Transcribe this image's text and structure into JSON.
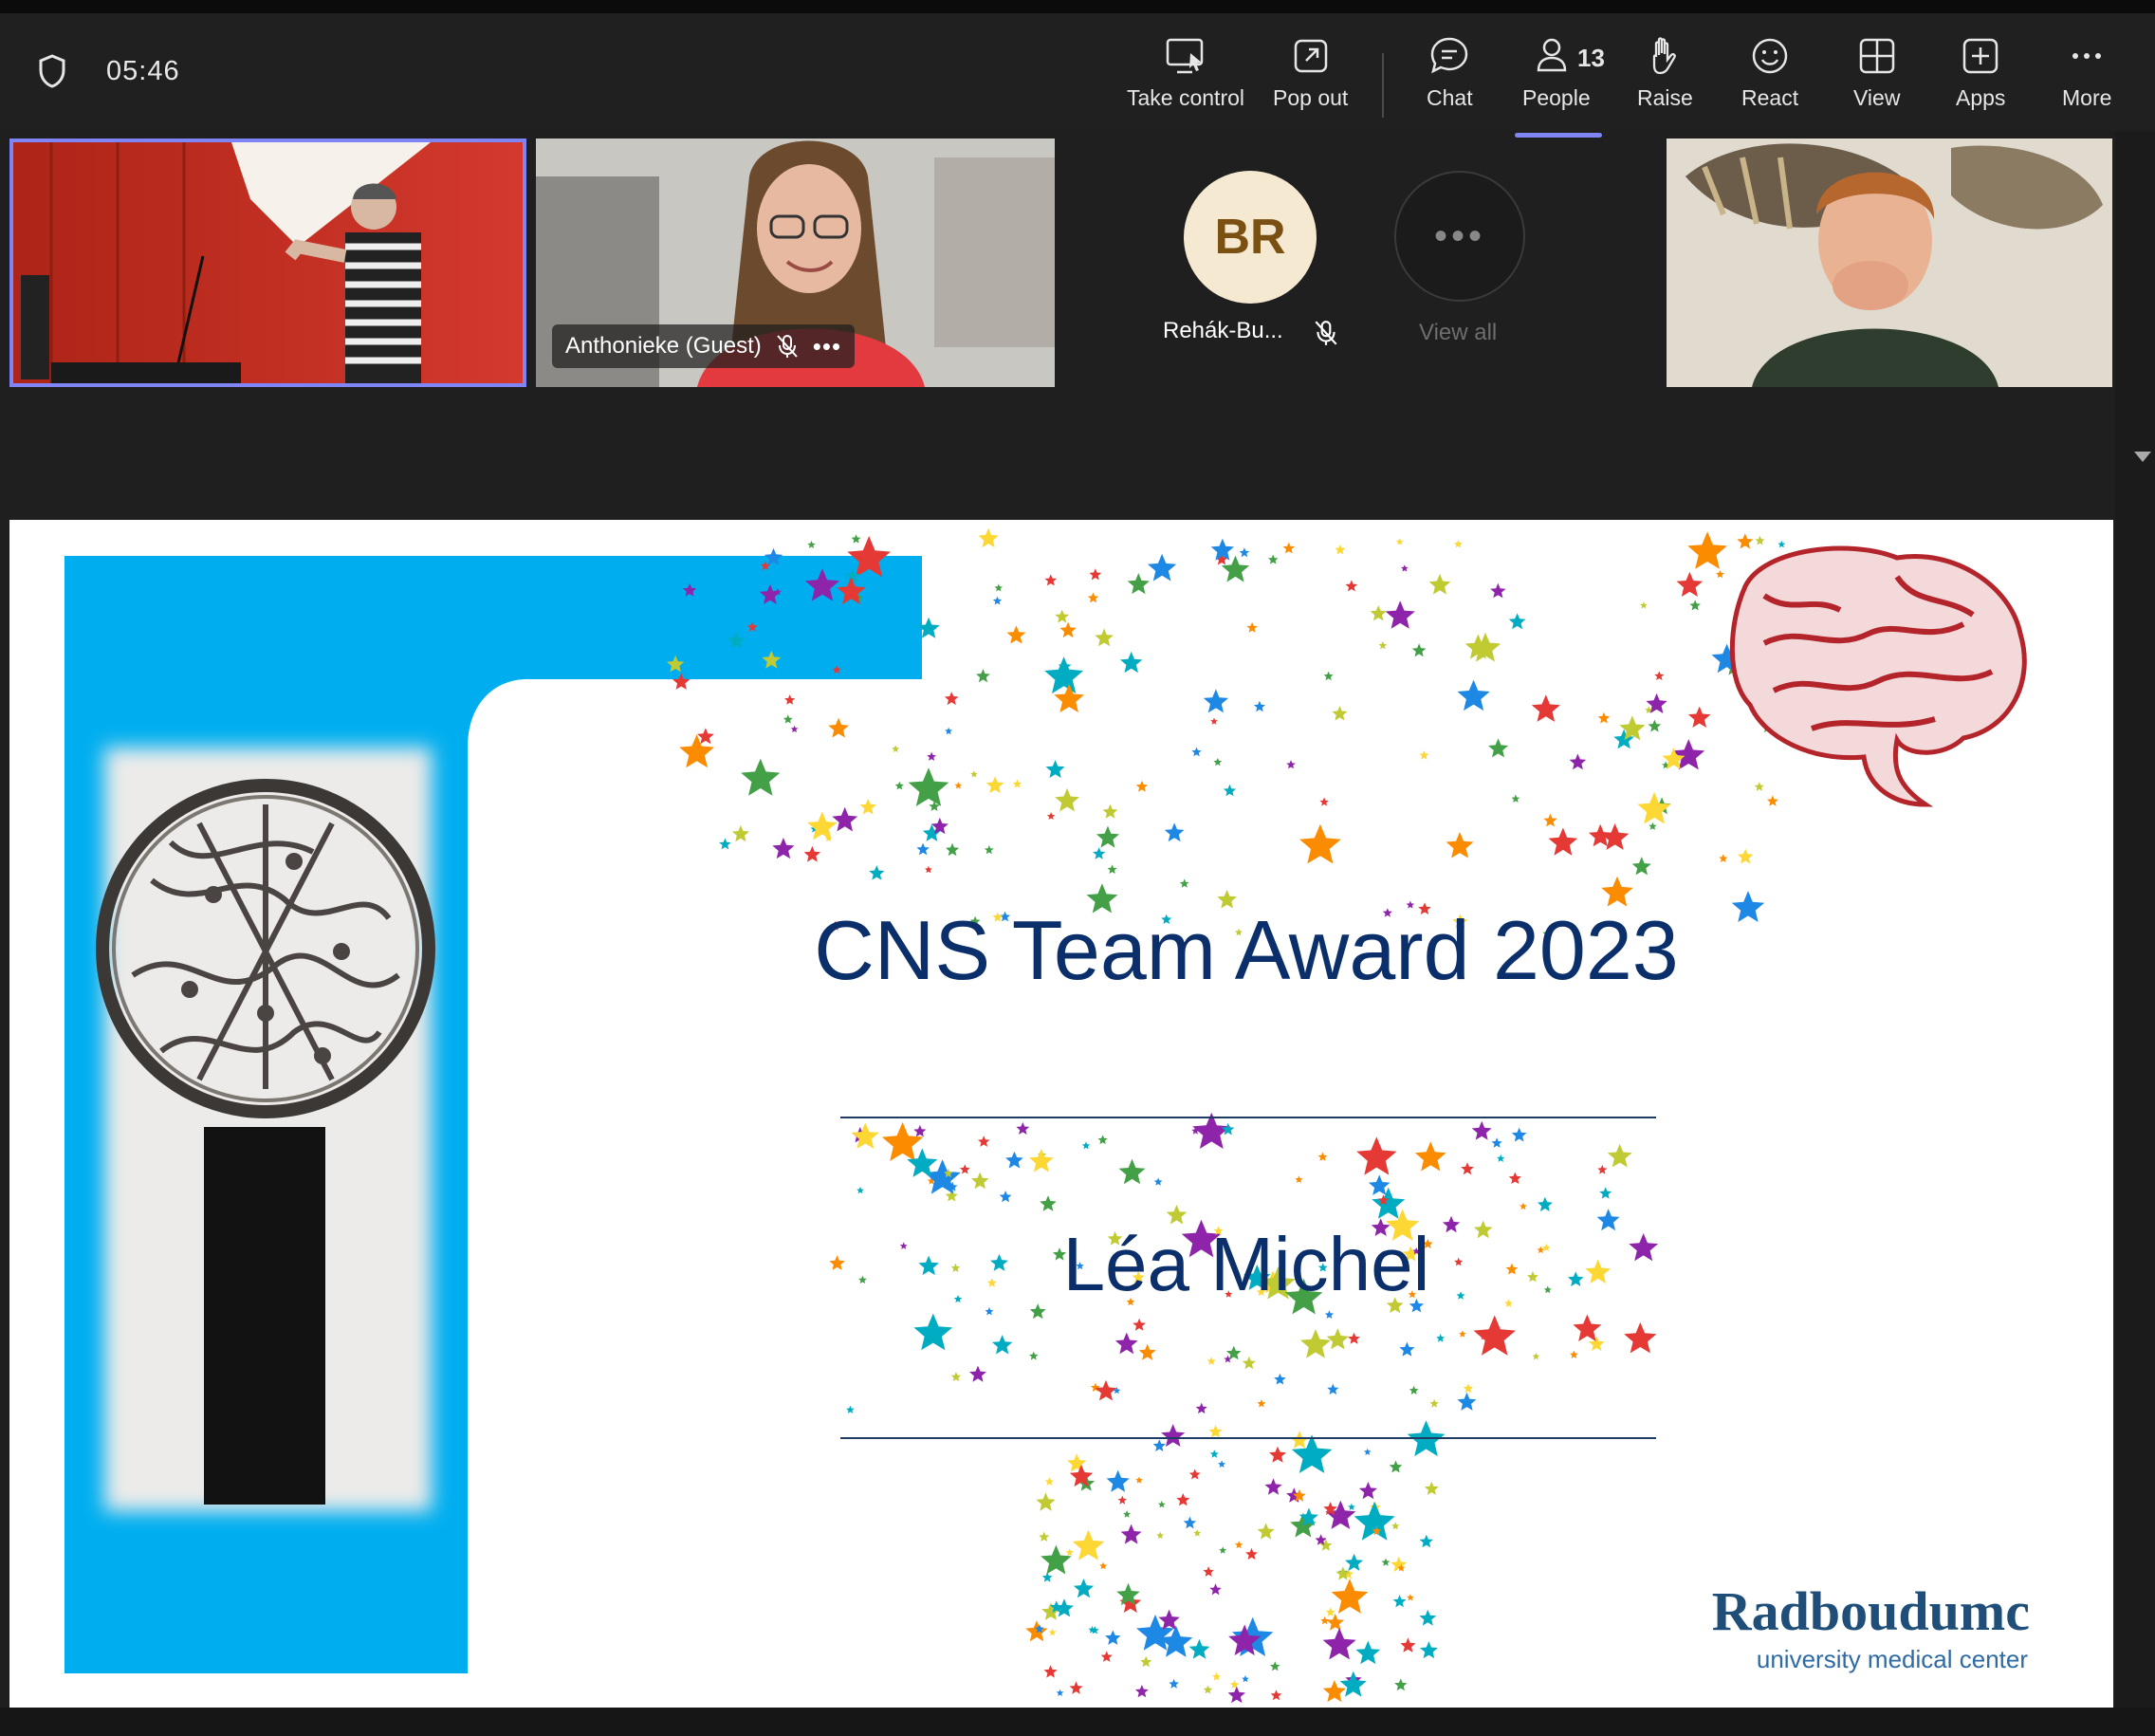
{
  "toolbar": {
    "timer": "05:46",
    "buttons": [
      {
        "label": "Take control",
        "icon": "take-control-icon"
      },
      {
        "label": "Pop out",
        "icon": "pop-out-icon"
      },
      {
        "label": "Chat",
        "icon": "chat-icon"
      },
      {
        "label": "People",
        "icon": "people-icon",
        "count": "13",
        "active": true
      },
      {
        "label": "Raise",
        "icon": "hand-icon"
      },
      {
        "label": "React",
        "icon": "smiley-icon"
      },
      {
        "label": "View",
        "icon": "grid-icon"
      },
      {
        "label": "Apps",
        "icon": "plus-icon"
      },
      {
        "label": "More",
        "icon": "more-icon"
      }
    ]
  },
  "participants": {
    "guest_name": "Anthonieke (Guest)",
    "avatar_initials": "BR",
    "avatar_name": "Rehák-Bu...",
    "view_all": "View all"
  },
  "slide": {
    "title": "CNS Team Award 2023",
    "winner": "Léa Michel",
    "logo_main": "Radboudumc",
    "logo_sub": "university medical center"
  },
  "colors": {
    "accent": "#7f85f5",
    "slide_blue": "#00aeef",
    "title_blue": "#0b2f6b",
    "logo_blue": "#1f4e79",
    "brain_red": "#b3242b"
  }
}
